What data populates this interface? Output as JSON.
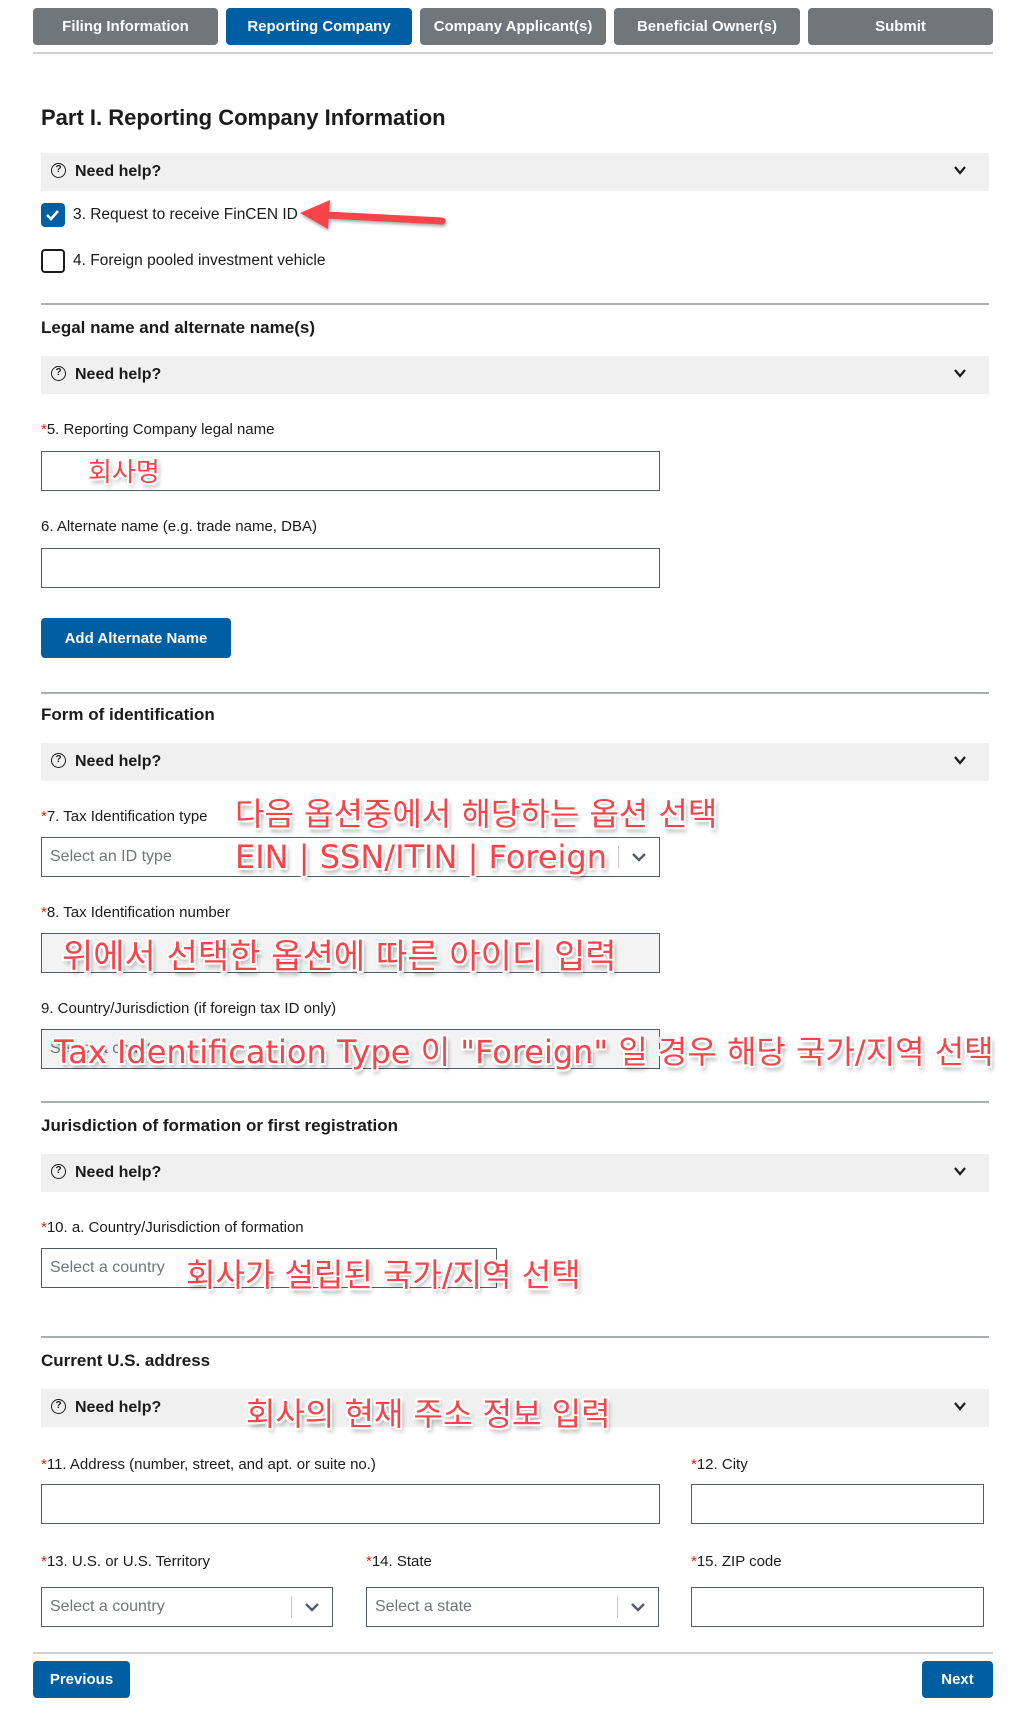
{
  "tabs": [
    {
      "label": "Filing Information",
      "active": false
    },
    {
      "label": "Reporting Company",
      "active": true
    },
    {
      "label": "Company Applicant(s)",
      "active": false
    },
    {
      "label": "Beneficial Owner(s)",
      "active": false
    },
    {
      "label": "Submit",
      "active": false
    }
  ],
  "page_title": "Part I. Reporting Company Information",
  "help_label": "Need help?",
  "checkboxes": [
    {
      "label": "3. Request to receive FinCEN ID",
      "checked": true
    },
    {
      "label": "4. Foreign pooled investment vehicle",
      "checked": false
    }
  ],
  "sections": {
    "legal_name": {
      "title": "Legal name and alternate name(s)",
      "field5_label": "5. Reporting Company legal name",
      "field5_value": "",
      "field6_label": "6. Alternate name (e.g. trade name, DBA)",
      "field6_value": "",
      "add_alternate_button": "Add Alternate Name"
    },
    "identification": {
      "title": "Form of identification",
      "field7_label": "7. Tax Identification type",
      "field7_placeholder": "Select an ID type",
      "field8_label": "8. Tax Identification number",
      "field8_value": "",
      "field9_label": "9. Country/Jurisdiction (if foreign tax ID only)",
      "field9_placeholder": "Select a country"
    },
    "jurisdiction": {
      "title": "Jurisdiction of formation or first registration",
      "field10_label": "10. a. Country/Jurisdiction of formation",
      "field10_placeholder": "Select a country"
    },
    "address": {
      "title": "Current U.S. address",
      "field11_label": "11. Address (number, street, and apt. or suite no.)",
      "field12_label": "12. City",
      "field13_label": "13. U.S. or U.S. Territory",
      "field13_placeholder": "Select a country",
      "field14_label": "14. State",
      "field14_placeholder": "Select a state",
      "field15_label": "15. ZIP code"
    }
  },
  "required_marker": "*",
  "nav": {
    "previous": "Previous",
    "next": "Next"
  },
  "annotations": {
    "company_name": "회사명",
    "id_type_line1": "다음 옵션중에서 해당하는 옵션 선택",
    "id_type_line2": "EIN | SSN/ITIN | Foreign",
    "id_number": "위에서 선택한 옵션에 따른 아이디 입력",
    "foreign_country": "Tax Identification Type 이 \"Foreign\" 일 경우 해당 국가/지역 선택",
    "formation_country": "회사가 설립된 국가/지역 선택",
    "address": "회사의 현재 주소 정보 입력"
  },
  "colors": {
    "primary": "#005ea2",
    "tab_inactive": "#71767a",
    "required": "#e52207",
    "annotation": "#f5444a"
  }
}
